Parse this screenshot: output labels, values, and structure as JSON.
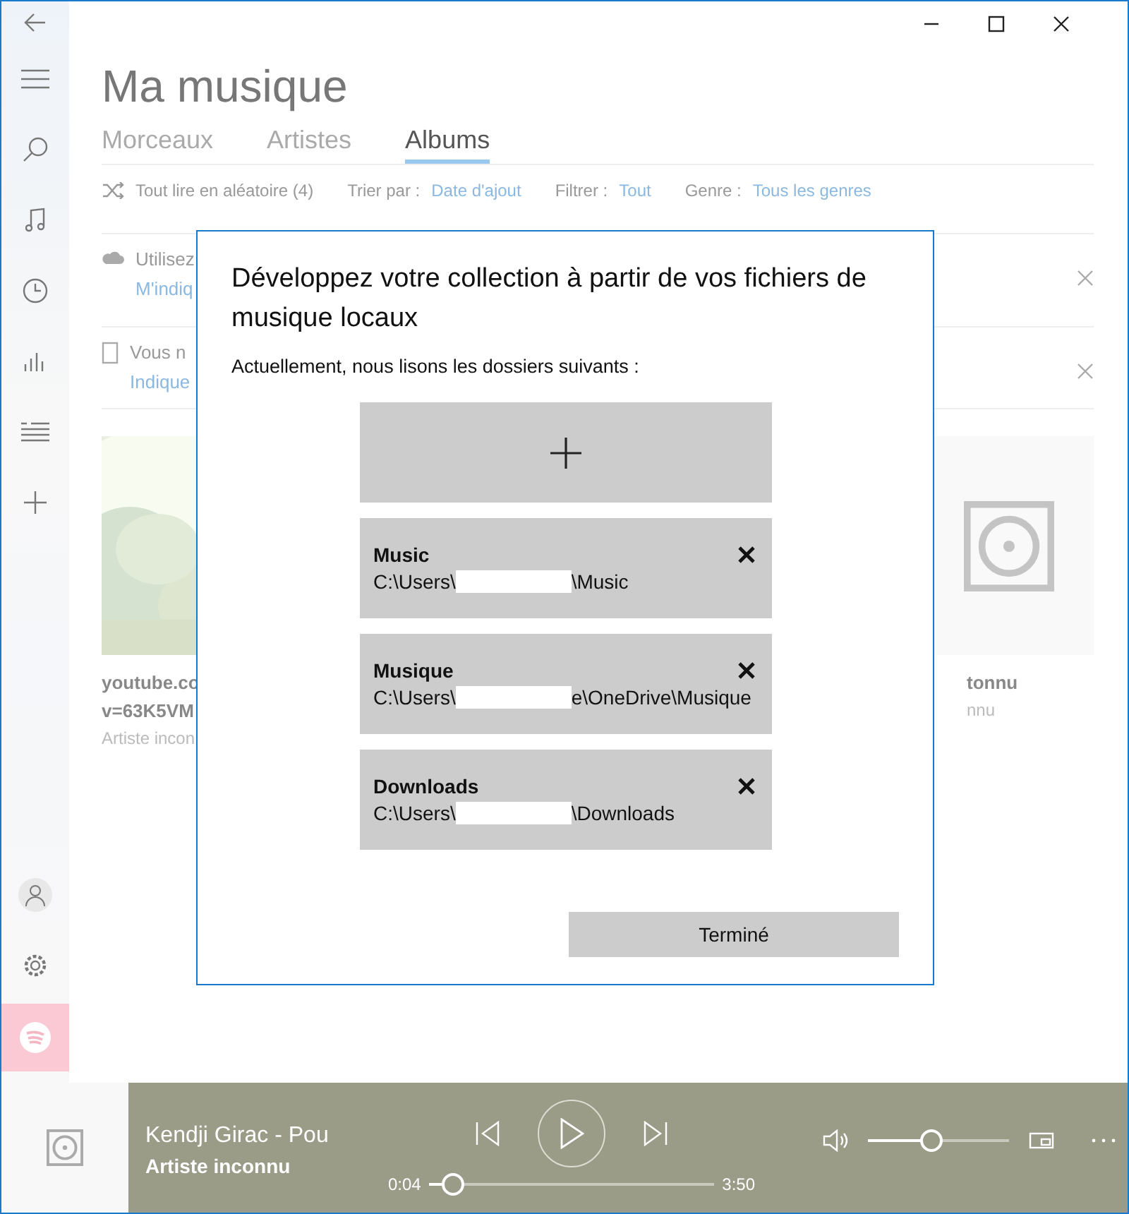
{
  "header": {
    "title": "Ma musique"
  },
  "tabs": [
    {
      "label": "Morceaux",
      "selected": false
    },
    {
      "label": "Artistes",
      "selected": false
    },
    {
      "label": "Albums",
      "selected": true
    }
  ],
  "toolbar": [
    {
      "kind": "shuffle",
      "label": "Tout lire en aléatoire (4)"
    },
    {
      "kind": "option",
      "label": "Trier par :",
      "value": "Date d'ajout"
    },
    {
      "kind": "option",
      "label": "Filtrer :",
      "value": "Tout"
    },
    {
      "kind": "option",
      "label": "Genre :",
      "value": "Tous les genres"
    }
  ],
  "notices": [
    {
      "kind": "cloud",
      "text": "Utilisez",
      "link": "M'indiq"
    },
    {
      "kind": "device",
      "text": "Vous n",
      "link": "Indique"
    }
  ],
  "albums": [
    {
      "kind": "picture",
      "lines": [
        "youtube.co",
        "v=63K5VM"
      ],
      "artist": "Artiste incon"
    },
    {
      "kind": "placeholder",
      "lines": [
        "tonnu"
      ],
      "artist": "nnu"
    }
  ],
  "dialog": {
    "title": "Développez votre collection à partir de vos fichiers de musique locaux",
    "subtitle": "Actuellement, nous lisons les dossiers suivants :",
    "folders": [
      {
        "name": "Music",
        "path_start": "C:\\Users\\",
        "path_end": "\\Music"
      },
      {
        "name": "Musique",
        "path_start": "C:\\Users\\",
        "path_end": "e\\OneDrive\\Musique"
      },
      {
        "name": "Downloads",
        "path_start": "C:\\Users\\",
        "path_end": "\\Downloads"
      }
    ],
    "done_button": "Terminé"
  },
  "player": {
    "track_title": "Kendji Girac - Pou",
    "artist": "Artiste inconnu",
    "elapsed": "0:04",
    "duration": "3:50",
    "seek": {
      "level": 0.085
    },
    "volume": {
      "level": 0.45
    }
  }
}
